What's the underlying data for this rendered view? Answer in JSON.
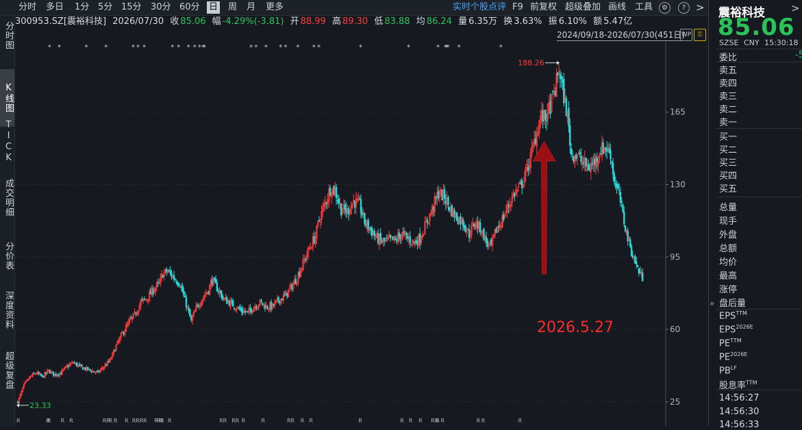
{
  "toolbar": {
    "tabs": [
      "分时",
      "多日",
      "1分",
      "5分",
      "15分",
      "30分",
      "60分",
      "日",
      "周",
      "月",
      "更多"
    ],
    "active_tab": "日",
    "links": [
      "实时个股点评",
      "F9",
      "前复权",
      "超级叠加",
      "画线",
      "工具"
    ],
    "help": "?",
    "chevron": ">"
  },
  "left_nav": [
    "分时图",
    "K线图",
    "TICK",
    "成交明细",
    "分价表",
    "深度资料",
    "超级复盘"
  ],
  "left_nav_active": "K线图",
  "info": {
    "code": "300953.SZ[震裕科技]",
    "date": "2026/07/30",
    "close_label": "收",
    "close": "85.06",
    "chg_label": "幅",
    "chg": "-4.29%(-3.81)",
    "open_label": "开",
    "open": "88.99",
    "high_label": "高",
    "high": "89.30",
    "low_label": "低",
    "low": "83.88",
    "avg_label": "均",
    "avg": "86.24",
    "vol_label": "量",
    "vol": "6.35万",
    "turn_label": "换",
    "turn": "3.63%",
    "amp_label": "振",
    "amp": "6.10%",
    "amt_label": "额",
    "amt": "5.47亿"
  },
  "date_range": "2024/09/18-2026/07/30(451日)",
  "icons": {
    "left": "wp-settings-icon",
    "right": "lock-icon"
  },
  "chart_data": {
    "type": "candlestick",
    "y_ticks": [
      25,
      60,
      95,
      130,
      165
    ],
    "ylim": [
      18,
      196
    ],
    "up_color": "#ff3b3b",
    "down_color": "#2ad8d8",
    "max_label": "188.26",
    "min_label": "23.33",
    "annotation": "2026.5.27",
    "close_path": [
      [
        0,
        25
      ],
      [
        5,
        33
      ],
      [
        10,
        37
      ],
      [
        15,
        39
      ],
      [
        20,
        37
      ],
      [
        25,
        40
      ],
      [
        30,
        38
      ],
      [
        35,
        39
      ],
      [
        40,
        42
      ],
      [
        45,
        44
      ],
      [
        50,
        42
      ],
      [
        55,
        41
      ],
      [
        60,
        40
      ],
      [
        65,
        39
      ],
      [
        75,
        45
      ],
      [
        80,
        52
      ],
      [
        85,
        58
      ],
      [
        90,
        63
      ],
      [
        95,
        67
      ],
      [
        100,
        73
      ],
      [
        105,
        75
      ],
      [
        110,
        79
      ],
      [
        115,
        82
      ],
      [
        118,
        87
      ],
      [
        122,
        88
      ],
      [
        127,
        85
      ],
      [
        132,
        82
      ],
      [
        135,
        76
      ],
      [
        138,
        70
      ],
      [
        141,
        64
      ],
      [
        145,
        70
      ],
      [
        150,
        75
      ],
      [
        155,
        79
      ],
      [
        158,
        84
      ],
      [
        162,
        80
      ],
      [
        167,
        75
      ],
      [
        172,
        73
      ],
      [
        177,
        71
      ],
      [
        182,
        69
      ],
      [
        187,
        68
      ],
      [
        192,
        71
      ],
      [
        197,
        73
      ],
      [
        202,
        71
      ],
      [
        207,
        71
      ],
      [
        212,
        74
      ],
      [
        217,
        76
      ],
      [
        222,
        80
      ],
      [
        227,
        85
      ],
      [
        232,
        92
      ],
      [
        237,
        99
      ],
      [
        242,
        105
      ],
      [
        245,
        113
      ],
      [
        250,
        121
      ],
      [
        254,
        128
      ],
      [
        258,
        127
      ],
      [
        263,
        118
      ],
      [
        268,
        117
      ],
      [
        273,
        122
      ],
      [
        278,
        120
      ],
      [
        282,
        112
      ],
      [
        287,
        108
      ],
      [
        292,
        104
      ],
      [
        297,
        102
      ],
      [
        302,
        103
      ],
      [
        307,
        103
      ],
      [
        312,
        106
      ],
      [
        317,
        104
      ],
      [
        322,
        102
      ],
      [
        327,
        104
      ],
      [
        332,
        111
      ],
      [
        337,
        118
      ],
      [
        342,
        126
      ],
      [
        347,
        124
      ],
      [
        352,
        118
      ],
      [
        357,
        114
      ],
      [
        362,
        112
      ],
      [
        367,
        106
      ],
      [
        372,
        112
      ],
      [
        377,
        108
      ],
      [
        382,
        101
      ],
      [
        385,
        100
      ],
      [
        389,
        108
      ],
      [
        394,
        113
      ],
      [
        399,
        120
      ],
      [
        404,
        126
      ],
      [
        409,
        129
      ],
      [
        412,
        134
      ],
      [
        416,
        141
      ],
      [
        421,
        153
      ],
      [
        425,
        163
      ],
      [
        429,
        162
      ],
      [
        433,
        168
      ],
      [
        437,
        176
      ],
      [
        440,
        186
      ],
      [
        443,
        176
      ],
      [
        447,
        163
      ],
      [
        450,
        145
      ],
      [
        455,
        144
      ],
      [
        460,
        140
      ],
      [
        465,
        138
      ],
      [
        470,
        142
      ],
      [
        474,
        147
      ],
      [
        478,
        148
      ],
      [
        482,
        145
      ],
      [
        485,
        132
      ],
      [
        489,
        125
      ],
      [
        493,
        112
      ],
      [
        497,
        102
      ],
      [
        501,
        94
      ],
      [
        505,
        88
      ],
      [
        508,
        85
      ]
    ],
    "star_markers": [
      26,
      34,
      56,
      72,
      94,
      98,
      103,
      126,
      131,
      139,
      144,
      148,
      151,
      152,
      190,
      194,
      202,
      214,
      218,
      228,
      241,
      245,
      279,
      318,
      342,
      348,
      349,
      350,
      359,
      393
    ],
    "r_markers": [
      0,
      24,
      25,
      36,
      43,
      70,
      73,
      75,
      79,
      88,
      94,
      97,
      100,
      103,
      112,
      114,
      116,
      117,
      123,
      165,
      168,
      175,
      178,
      183,
      199,
      220,
      223,
      231,
      238,
      278,
      312,
      319,
      327,
      337,
      340,
      341,
      345,
      374,
      378,
      408
    ]
  },
  "right_panel": {
    "name": "震裕科技",
    "price": "85.06",
    "exchange": "SZSE",
    "currency": "CNY",
    "time": "15:30:18",
    "chevron": ">",
    "weibi_label": "委比",
    "weibi_value": "-5",
    "sells": [
      "卖五",
      "卖四",
      "卖三",
      "卖二",
      "卖一"
    ],
    "buys": [
      "买一",
      "买二",
      "买三",
      "买四",
      "买五"
    ],
    "stats": [
      "总量",
      "现手",
      "外盘",
      "总额",
      "均价",
      "最高",
      "涨停",
      "盘后量"
    ],
    "metrics": [
      {
        "label": "EPS",
        "sup": "TTM"
      },
      {
        "label": "EPS",
        "sup": "2026E"
      },
      {
        "label": "PE",
        "sup": "TTM"
      },
      {
        "label": "PE",
        "sup": "2026E"
      },
      {
        "label": "PB",
        "sup": "LF"
      },
      {
        "label": "股息率",
        "sup": "TTM"
      }
    ],
    "times": [
      "14:56:27",
      "14:56:30",
      "14:56:33"
    ]
  },
  "expand_arrow": "»"
}
